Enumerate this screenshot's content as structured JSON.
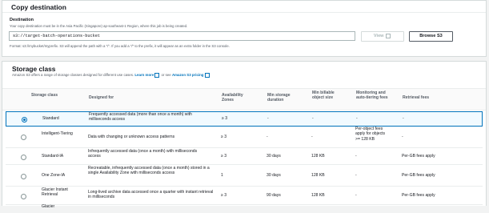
{
  "copy_destination": {
    "title": "Copy destination",
    "label": "Destination",
    "description": "Your copy destination must be in the Asia Pacific (Singapore) ap-southeast-1 Region, where this job is being created.",
    "input_value": "s3://target-batch-operations-bucket",
    "view_button": "View",
    "browse_button": "Browse S3",
    "format_hint": "Format: s3://mybucket/myprefix. S3 will append the path with a \"/\". If you add a \"/\" to the prefix, it will appear as an extra folder in the S3 console."
  },
  "storage_class": {
    "title": "Storage class",
    "description": "Amazon S3 offers a range of storage classes designed for different use cases.",
    "learn_more": "Learn more",
    "or_see": "or see",
    "pricing_link": "Amazon S3 pricing",
    "columns": [
      "Storage class",
      "Designed for",
      "Availability Zones",
      "Min storage duration",
      "Min billable object size",
      "Monitoring and auto-tiering fees",
      "Retrieval fees"
    ],
    "rows": [
      {
        "name": "Standard",
        "designed_for": "Frequently accessed data (more than once a month) with milliseconds access",
        "az": "≥ 3",
        "min_duration": "-",
        "min_size": "-",
        "monitoring": "-",
        "retrieval": "-",
        "selected": true
      },
      {
        "name": "Intelligent-Tiering",
        "designed_for": "Data with changing or unknown access patterns",
        "az": "≥ 3",
        "min_duration": "-",
        "min_size": "-",
        "monitoring": "Per-object fees apply for objects >= 128 KB",
        "retrieval": "-",
        "selected": false
      },
      {
        "name": "Standard-IA",
        "designed_for": "Infrequently accessed data (once a month) with milliseconds access",
        "az": "≥ 3",
        "min_duration": "30 days",
        "min_size": "128 KB",
        "monitoring": "-",
        "retrieval": "Per-GB fees apply",
        "selected": false
      },
      {
        "name": "One Zone-IA",
        "designed_for": "Recreatable, infrequently accessed data (once a month) stored in a single Availability Zone with milliseconds access",
        "az": "1",
        "min_duration": "30 days",
        "min_size": "128 KB",
        "monitoring": "-",
        "retrieval": "Per-GB fees apply",
        "selected": false
      },
      {
        "name": "Glacier Instant Retrieval",
        "designed_for": "Long-lived archive data accessed once a quarter with instant retrieval in milliseconds",
        "az": "≥ 3",
        "min_duration": "90 days",
        "min_size": "128 KB",
        "monitoring": "-",
        "retrieval": "Per-GB fees apply",
        "selected": false
      },
      {
        "name": "Glacier",
        "designed_for": "",
        "az": "",
        "min_duration": "",
        "min_size": "",
        "monitoring": "",
        "retrieval": "",
        "selected": false
      }
    ]
  }
}
